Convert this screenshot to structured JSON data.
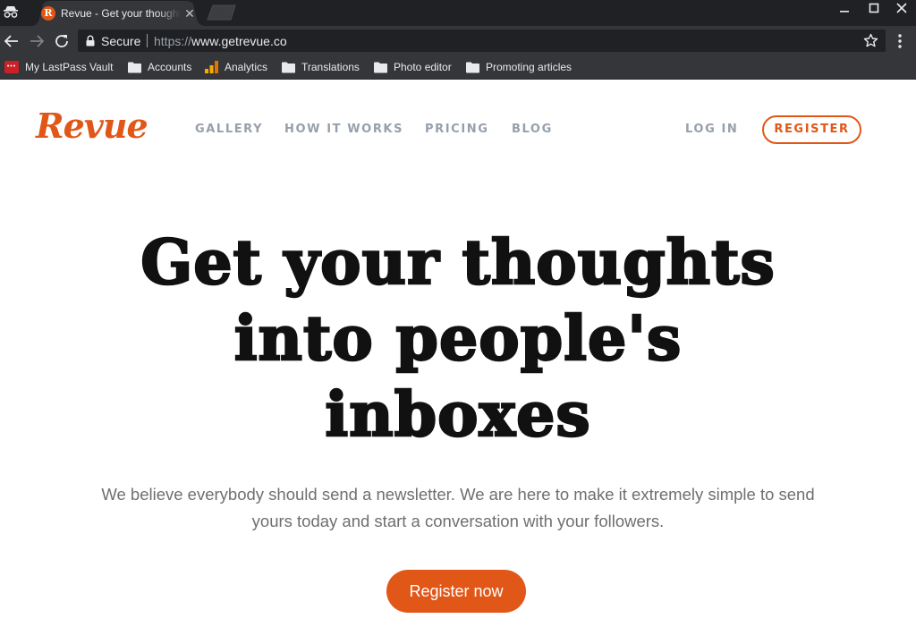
{
  "browser": {
    "tab": {
      "title": "Revue - Get your thoughts into people's inboxes",
      "favicon_letter": "R",
      "close_glyph": "✕"
    },
    "omnibox": {
      "secure_label": "Secure",
      "url_scheme": "https://",
      "url_host": "www.getrevue.co"
    },
    "bookmarks": [
      {
        "label": "My LastPass Vault",
        "icon": "lastpass-icon",
        "lastpass_glyph": "•••"
      },
      {
        "label": "Accounts",
        "icon": "folder-icon"
      },
      {
        "label": "Analytics",
        "icon": "analytics-icon"
      },
      {
        "label": "Translations",
        "icon": "folder-icon"
      },
      {
        "label": "Photo editor",
        "icon": "folder-icon"
      },
      {
        "label": "Promoting articles",
        "icon": "folder-icon"
      }
    ],
    "colors": {
      "titlebar": "#202124",
      "toolbar": "#35363a"
    }
  },
  "site": {
    "logo": "Revue",
    "nav": {
      "gallery": "GALLERY",
      "how_it_works": "HOW IT WORKS",
      "pricing": "PRICING",
      "blog": "BLOG",
      "login": "LOG IN",
      "register": "REGISTER"
    },
    "hero": {
      "line1": "Get your thoughts",
      "line2": "into people's",
      "line3": "inboxes"
    },
    "subheading": {
      "line1": "We believe everybody should send a newsletter. We are here to make it extremely simple to send",
      "line2": "yours today and start a conversation with your followers."
    },
    "cta_label": "Register now",
    "colors": {
      "brand": "#e15718",
      "nav": "#96a0ab",
      "heading": "#111111",
      "body_text": "#6f6f6f"
    }
  }
}
